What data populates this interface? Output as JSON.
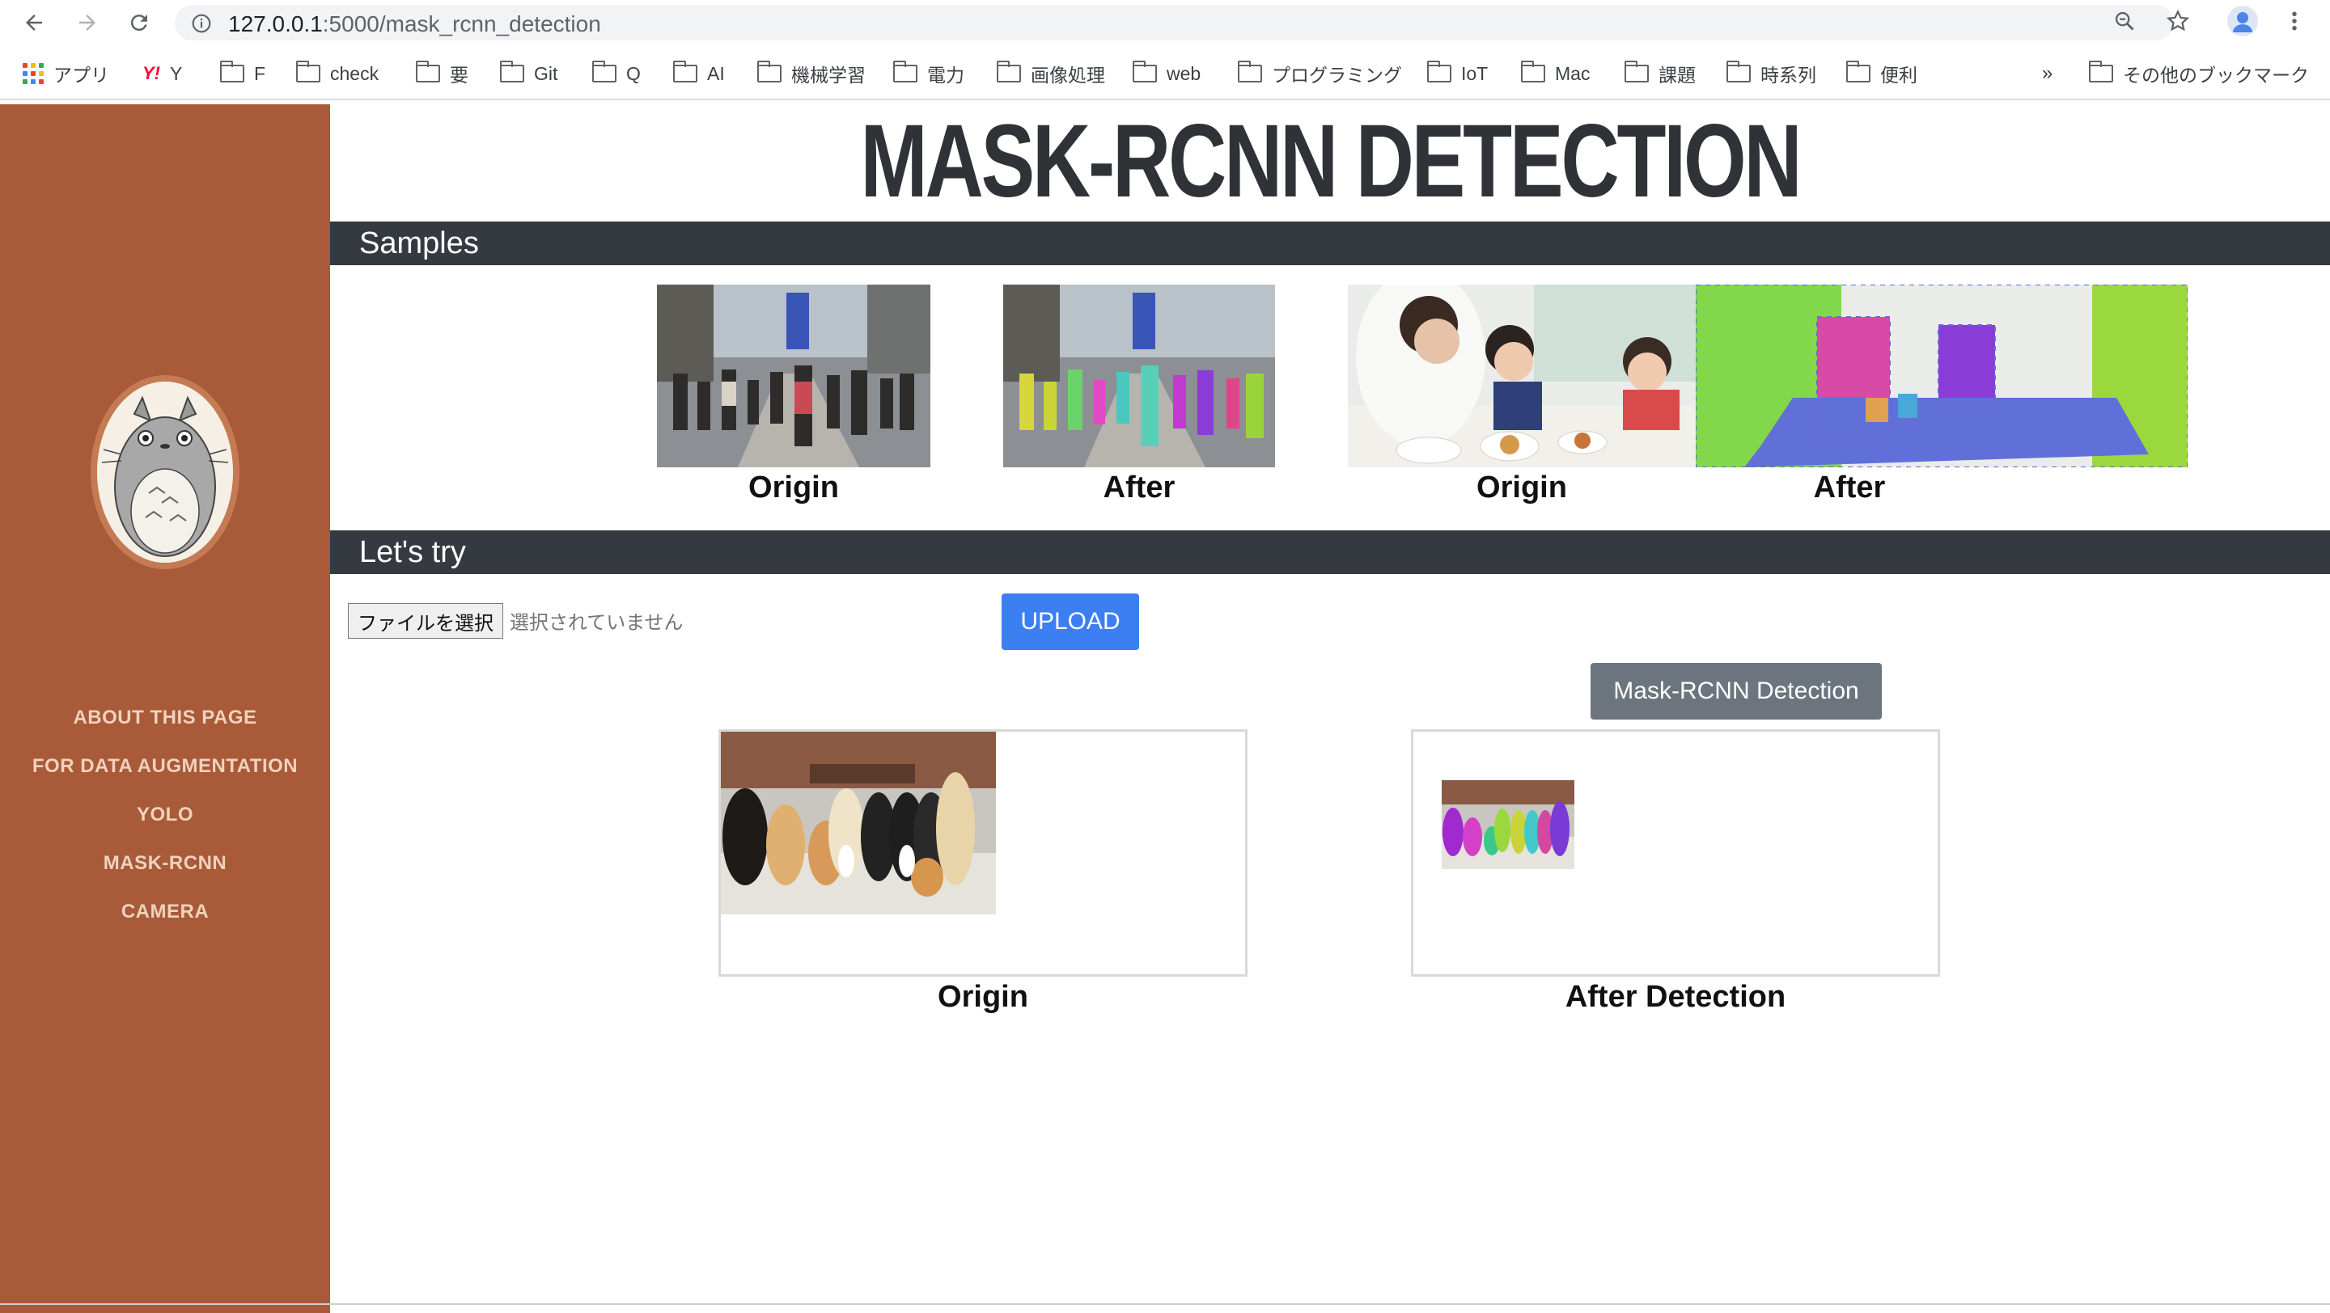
{
  "browser": {
    "url_host": "127.0.0.1",
    "url_path": ":5000/mask_rcnn_detection",
    "bookmarks": [
      "アプリ",
      "Y",
      "F",
      "check",
      "要",
      "Git",
      "Q",
      "AI",
      "機械学習",
      "電力",
      "画像処理",
      "web",
      "プログラミング",
      "IoT",
      "Mac",
      "課題",
      "時系列",
      "便利"
    ],
    "overflow": "»",
    "other_bookmarks": "その他のブックマーク"
  },
  "sidebar": {
    "items": [
      "ABOUT THIS PAGE",
      "FOR DATA AUGMENTATION",
      "YOLO",
      "MASK-RCNN",
      "CAMERA"
    ],
    "accent": "#a85a39"
  },
  "page": {
    "title": "MASK-RCNN DETECTION",
    "samples_heading": "Samples",
    "samples": [
      {
        "caption": "Origin"
      },
      {
        "caption": "After"
      },
      {
        "caption": "Origin"
      },
      {
        "caption": "After"
      }
    ],
    "try_heading": "Let's try",
    "file_button": "ファイルを選択",
    "file_status": "選択されていません",
    "upload_label": "UPLOAD",
    "detect_label": "Mask-RCNN Detection",
    "origin_caption": "Origin",
    "after_caption": "After Detection"
  }
}
